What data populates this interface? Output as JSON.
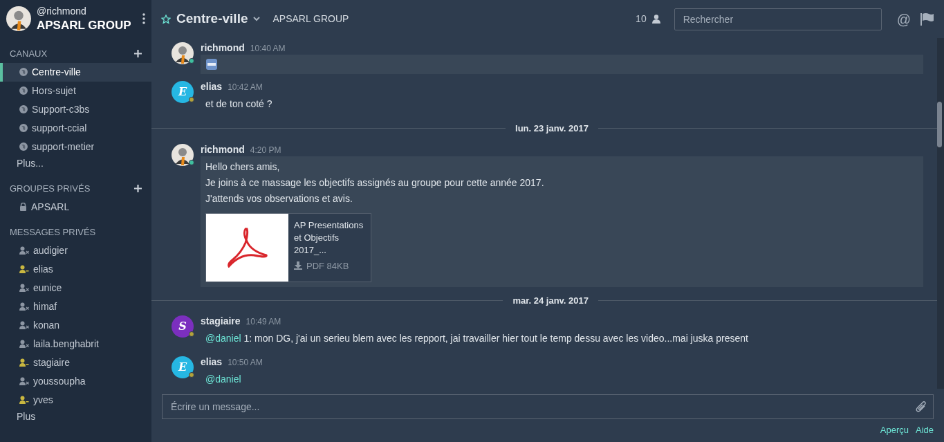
{
  "sidebar": {
    "username": "@richmond",
    "team": "APSARL GROUP",
    "sections": [
      {
        "title": "CANAUX",
        "kind": "channels",
        "add": true,
        "items": [
          {
            "label": "Centre-ville",
            "selected": true
          },
          {
            "label": "Hors-sujet",
            "selected": false
          },
          {
            "label": "Support-c3bs",
            "selected": false
          },
          {
            "label": "support-ccial",
            "selected": false
          },
          {
            "label": "support-metier",
            "selected": false
          }
        ],
        "more": "Plus..."
      },
      {
        "title": "GROUPES PRIVÉS",
        "kind": "private",
        "add": true,
        "items": [
          {
            "label": "APSARL",
            "selected": false
          }
        ]
      },
      {
        "title": "MESSAGES PRIVÉS",
        "kind": "direct",
        "items": [
          {
            "label": "audigier",
            "selected": false,
            "away": false
          },
          {
            "label": "elias",
            "selected": false,
            "away": true
          },
          {
            "label": "eunice",
            "selected": false,
            "away": false
          },
          {
            "label": "himaf",
            "selected": false,
            "away": false
          },
          {
            "label": "konan",
            "selected": false,
            "away": false
          },
          {
            "label": "laila.benghabrit",
            "selected": false,
            "away": false
          },
          {
            "label": "stagiaire",
            "selected": false,
            "away": true
          },
          {
            "label": "youssoupha",
            "selected": false,
            "away": false
          },
          {
            "label": "yves",
            "selected": false,
            "away": true
          }
        ],
        "more": "Plus"
      }
    ]
  },
  "header": {
    "channel": "Centre-ville",
    "team": "APSARL GROUP",
    "members": "10",
    "search_placeholder": "Rechercher",
    "mentions_icon": "@"
  },
  "feed": [
    {
      "kind": "message",
      "author": "richmond",
      "time": "10:40 AM",
      "away": false,
      "highlighted": true,
      "emoji": true
    },
    {
      "kind": "message",
      "author": "elias",
      "time": "10:42 AM",
      "letter": "E",
      "color": "#26b7e3",
      "away": true,
      "lines": [
        "et de ton coté ?"
      ]
    },
    {
      "kind": "date",
      "label": "lun. 23 janv. 2017"
    },
    {
      "kind": "message",
      "author": "richmond",
      "time": "4:20 PM",
      "away": false,
      "highlighted": true,
      "lines": [
        "Hello chers amis,",
        "Je joins à ce massage les objectifs assignés au groupe pour cette année 2017.",
        "J'attends vos observations et avis."
      ],
      "attachment": {
        "name": "AP Presentations et Objectifs 2017_...",
        "meta": "PDF 84KB"
      }
    },
    {
      "kind": "date",
      "label": "mar. 24 janv. 2017"
    },
    {
      "kind": "message",
      "author": "stagiaire",
      "time": "10:49 AM",
      "letter": "S",
      "color": "#7b2fbe",
      "away": true,
      "mention": "@daniel",
      "lines": [
        "1: mon DG, j'ai un serieu blem avec les repport, jai travailler hier tout le temp dessu avec les video...mai juska present"
      ]
    },
    {
      "kind": "message",
      "author": "elias",
      "time": "10:50 AM",
      "letter": "E",
      "color": "#26b7e3",
      "away": true,
      "mention": "@daniel"
    }
  ],
  "composer": {
    "placeholder": "Écrire un message...",
    "links": [
      "Aperçu",
      "Aide"
    ]
  }
}
